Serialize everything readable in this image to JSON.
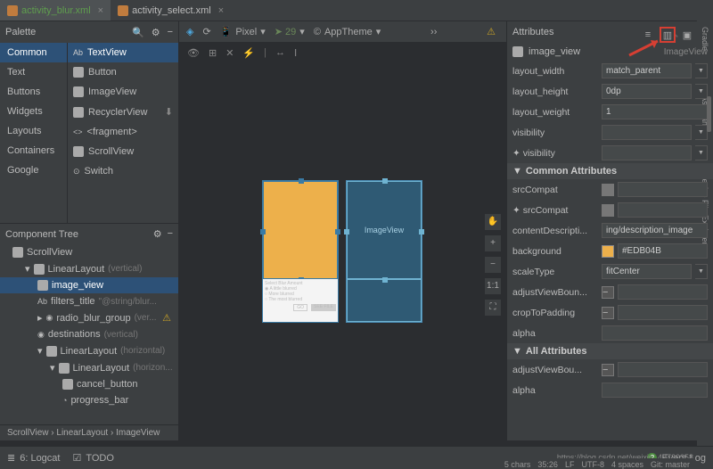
{
  "tabs": [
    {
      "label": "activity_blur.xml",
      "active": true
    },
    {
      "label": "activity_select.xml",
      "active": false
    }
  ],
  "palette": {
    "title": "Palette",
    "categories": [
      "Common",
      "Text",
      "Buttons",
      "Widgets",
      "Layouts",
      "Containers",
      "Google"
    ],
    "items": [
      "TextView",
      "Button",
      "ImageView",
      "RecyclerView",
      "<fragment>",
      "ScrollView",
      "Switch"
    ],
    "sel_item": "TextView"
  },
  "design_toolbar": {
    "device": "Pixel",
    "api": "29",
    "theme": "AppTheme"
  },
  "tree": {
    "title": "Component Tree",
    "rows": [
      {
        "icon": "scroll",
        "label": "ScrollView",
        "hint": "",
        "indent": 0
      },
      {
        "icon": "ll",
        "label": "LinearLayout",
        "hint": "(vertical)",
        "indent": 1
      },
      {
        "icon": "img",
        "label": "image_view",
        "hint": "",
        "indent": 2,
        "sel": true
      },
      {
        "icon": "txt",
        "label": "filters_title",
        "hint": "\"@string/blur...",
        "indent": 2
      },
      {
        "icon": "rg",
        "label": "radio_blur_group",
        "hint": "(ver...",
        "indent": 2,
        "warn": true
      },
      {
        "icon": "rg",
        "label": "destinations",
        "hint": "(vertical)",
        "indent": 2
      },
      {
        "icon": "ll",
        "label": "LinearLayout",
        "hint": "(horizontal)",
        "indent": 2
      },
      {
        "icon": "ll",
        "label": "LinearLayout",
        "hint": "(horizon...",
        "indent": 3
      },
      {
        "icon": "btn",
        "label": "cancel_button",
        "hint": "",
        "indent": 4
      },
      {
        "icon": "pb",
        "label": "progress_bar",
        "hint": "",
        "indent": 4
      }
    ]
  },
  "breadcrumb": "ScrollView  ›  LinearLayout  ›  ImageView",
  "attributes": {
    "title": "Attributes",
    "id": "image_view",
    "class": "ImageView",
    "rows": [
      {
        "name": "layout_width",
        "value": "match_parent",
        "dd": true
      },
      {
        "name": "layout_height",
        "value": "0dp",
        "dd": true
      },
      {
        "name": "layout_weight",
        "value": "1"
      },
      {
        "name": "visibility",
        "value": "",
        "dd": true
      },
      {
        "name": "✦ visibility",
        "value": "",
        "dd": true
      }
    ],
    "common_title": "Common Attributes",
    "common": [
      {
        "name": "srcCompat",
        "value": "",
        "swatch": "img"
      },
      {
        "name": "✦ srcCompat",
        "value": "",
        "swatch": "img"
      },
      {
        "name": "contentDescripti...",
        "value": "ing/description_image"
      },
      {
        "name": "background",
        "value": "#EDB04B",
        "swatch": "color"
      },
      {
        "name": "scaleType",
        "value": "fitCenter",
        "dd": true
      },
      {
        "name": "adjustViewBoun...",
        "value": "",
        "swatch": "chk"
      },
      {
        "name": "cropToPadding",
        "value": "",
        "swatch": "chk"
      },
      {
        "name": "alpha",
        "value": ""
      }
    ],
    "all_title": "All Attributes",
    "all": [
      {
        "name": "adjustViewBou...",
        "value": "",
        "swatch": "chk"
      },
      {
        "name": "alpha",
        "value": ""
      }
    ]
  },
  "blueprint_label": "ImageView",
  "bottom": {
    "logcat": "6: Logcat",
    "todo": "TODO",
    "eventlog": "Event Log"
  },
  "status": {
    "chars": "5 chars",
    "pos": "35:26",
    "le": "LF",
    "enc": "UTF-8",
    "spaces": "4 spaces",
    "git": "Git: master"
  },
  "right_gutter": [
    "Gradle",
    "Assistant",
    "Device File Explorer"
  ],
  "watermark": "https://blog.csdn.net/weixin_42730358",
  "zoom": {
    "plus": "+",
    "minus": "−",
    "fit": "1:1",
    "full": "⛶"
  }
}
